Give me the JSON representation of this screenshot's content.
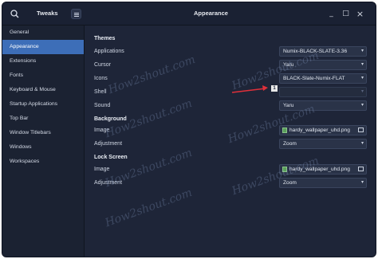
{
  "header": {
    "left_title": "Tweaks",
    "center_title": "Appearance",
    "controls": {
      "minimize": "_",
      "maximize": "□",
      "close": "×"
    }
  },
  "sidebar": {
    "items": [
      {
        "label": "General"
      },
      {
        "label": "Appearance"
      },
      {
        "label": "Extensions"
      },
      {
        "label": "Fonts"
      },
      {
        "label": "Keyboard & Mouse"
      },
      {
        "label": "Startup Applications"
      },
      {
        "label": "Top Bar"
      },
      {
        "label": "Window Titlebars"
      },
      {
        "label": "Windows"
      },
      {
        "label": "Workspaces"
      }
    ]
  },
  "themes": {
    "heading": "Themes",
    "applications_label": "Applications",
    "applications_value": "Numix-BLACK-SLATE-3.36",
    "cursor_label": "Cursor",
    "cursor_value": "Yaru",
    "icons_label": "Icons",
    "icons_value": "BLACK-Slate-Numix-FLAT",
    "shell_label": "Shell",
    "shell_value": "",
    "sound_label": "Sound",
    "sound_value": "Yaru"
  },
  "background": {
    "heading": "Background",
    "image_label": "Image",
    "image_value": "hardy_wallpaper_uhd.png",
    "adjustment_label": "Adjustment",
    "adjustment_value": "Zoom"
  },
  "lock_screen": {
    "heading": "Lock Screen",
    "image_label": "Image",
    "image_value": "hardy_wallpaper_uhd.png",
    "adjustment_label": "Adjustment",
    "adjustment_value": "Zoom"
  },
  "annotation": {
    "badge": "1",
    "arrow_color": "#e0303a"
  },
  "watermark_text": "How2shout.com",
  "colors": {
    "accent": "#3d6eb8",
    "bg": "#1e2538"
  }
}
